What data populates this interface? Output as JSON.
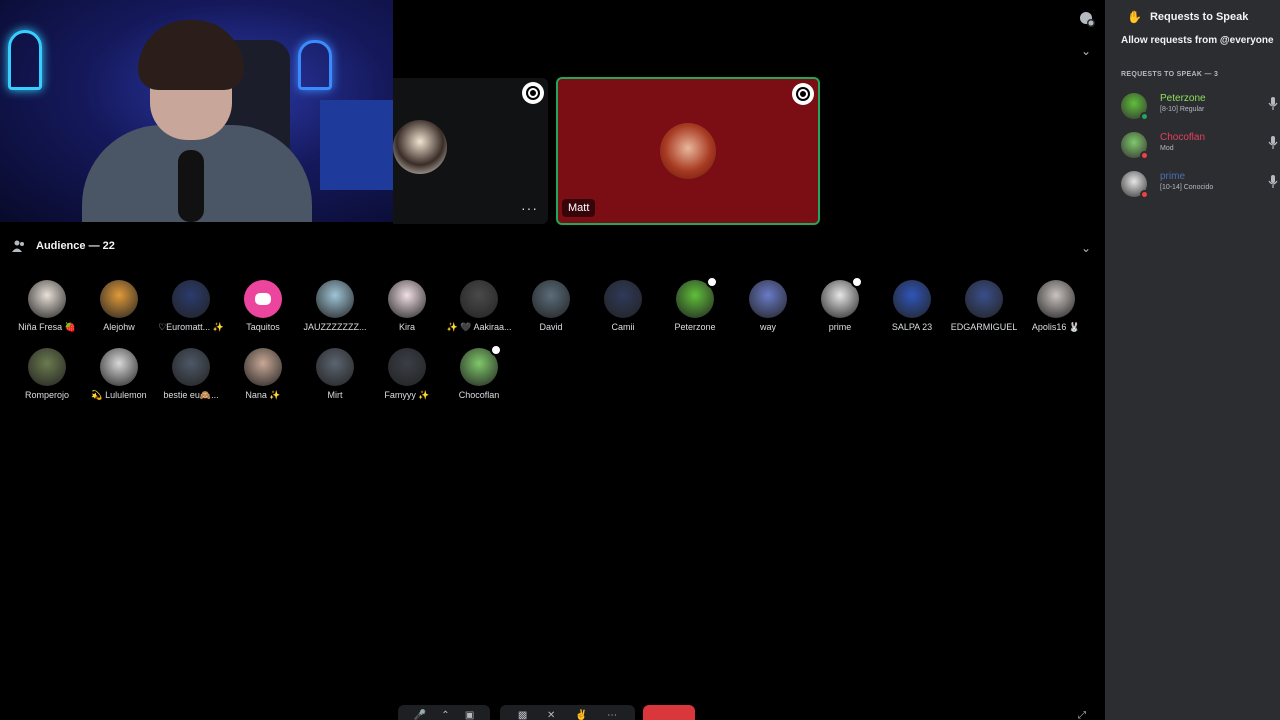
{
  "stage": {
    "tile_user": "Matt",
    "tile_more": "···"
  },
  "audience": {
    "header": "Audience — 22",
    "members": [
      {
        "name": "Niña Fresa 🍓",
        "color": "#e8e0d8",
        "mod": false
      },
      {
        "name": "Alejohw",
        "color": "#e09a3a",
        "mod": false
      },
      {
        "name": "♡Euromatt... ✨",
        "color": "#2a3b6e",
        "mod": false
      },
      {
        "name": "Taquitos",
        "color": "#eb459e",
        "mod": false,
        "discord": true
      },
      {
        "name": "JAUZZZZZZZ...",
        "color": "#9fc4d6",
        "mod": false
      },
      {
        "name": "Kira",
        "color": "#f1dfe6",
        "mod": false
      },
      {
        "name": "✨ 🖤 Aakiraa...",
        "color": "#4a4a4a",
        "mod": false
      },
      {
        "name": "David",
        "color": "#5a6d7a",
        "mod": false
      },
      {
        "name": "Camii",
        "color": "#2f3a5a",
        "mod": false
      },
      {
        "name": "Peterzone",
        "color": "#5fbf3a",
        "mod": true
      },
      {
        "name": "way",
        "color": "#6a7ac8",
        "mod": false
      },
      {
        "name": "prime",
        "color": "#e6e6e6",
        "mod": true
      },
      {
        "name": "SALPA 23",
        "color": "#2f55b8",
        "mod": false
      },
      {
        "name": "EDGARMIGUEL",
        "color": "#3a4f8a",
        "mod": false
      },
      {
        "name": "Apolis16 🐰",
        "color": "#c9c3c0",
        "mod": false
      },
      {
        "name": "Romperojo",
        "color": "#6b7b4e",
        "mod": false
      },
      {
        "name": "💫 Lululemon",
        "color": "#d8d8d8",
        "mod": false
      },
      {
        "name": "bestie eu🙈...",
        "color": "#4d5866",
        "mod": false
      },
      {
        "name": "Nana ✨",
        "color": "#c8a896",
        "mod": false
      },
      {
        "name": "Mirt",
        "color": "#5b6470",
        "mod": false
      },
      {
        "name": "Famyyy ✨",
        "color": "#3a3e46",
        "mod": false
      },
      {
        "name": "Chocoflan",
        "color": "#7fc86a",
        "mod": true
      }
    ]
  },
  "panel": {
    "title": "Requests to Speak",
    "allow": "Allow requests from @everyone",
    "heading": "REQUESTS TO SPEAK — 3",
    "requests": [
      {
        "name": "Peterzone",
        "sub": "[8-10] Regular",
        "name_color": "#8ee05a",
        "status": "#23a55a",
        "avatar": "#5fbf3a"
      },
      {
        "name": "Chocoflan",
        "sub": "Mod",
        "name_color": "#e2405a",
        "status": "#f23f43",
        "avatar": "#7fc86a"
      },
      {
        "name": "prime",
        "sub": "[10-14] Conocido",
        "name_color": "#4f6fb0",
        "status": "#f23f43",
        "avatar": "#e6e6e6"
      }
    ]
  },
  "colors": {
    "panel_bg": "#2b2d31",
    "tile_red": "#7b0d14",
    "speaking_border": "#23a55a",
    "leave": "#da373c"
  }
}
